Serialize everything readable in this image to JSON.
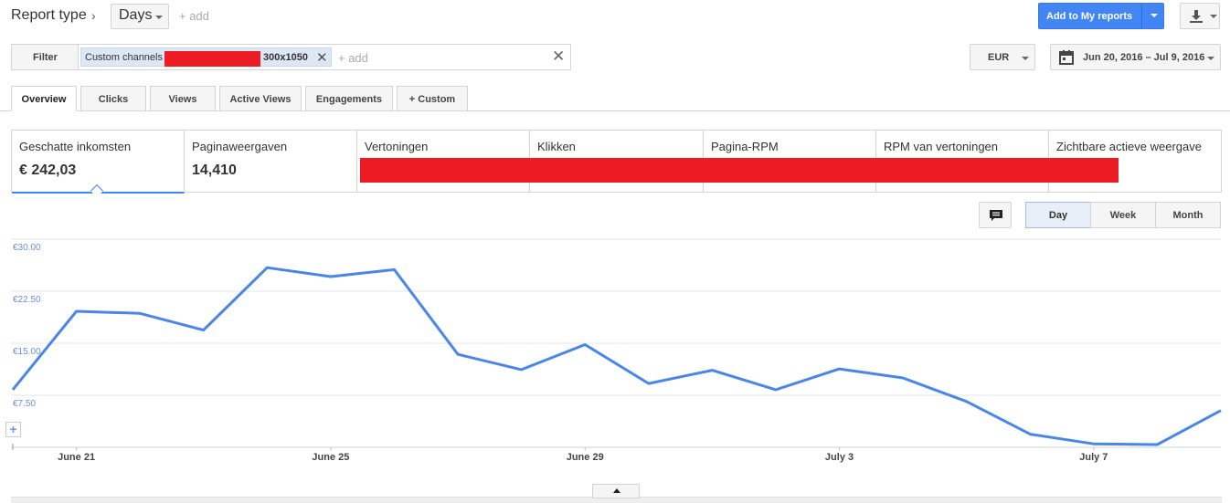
{
  "header": {
    "title": "Report type",
    "days_label": "Days",
    "add_label": "+ add",
    "add_reports_label": "Add to My reports"
  },
  "filter": {
    "button_label": "Filter",
    "chip_label": "Custom channels",
    "chip_size": "300x1050",
    "add_label": "+ add"
  },
  "currency": "EUR",
  "date_range": "Jun 20, 2016 – Jul 9, 2016",
  "tabs": [
    {
      "label": "Overview"
    },
    {
      "label": "Clicks"
    },
    {
      "label": "Views"
    },
    {
      "label": "Active Views"
    },
    {
      "label": "Engagements"
    },
    {
      "label": "+ Custom"
    }
  ],
  "metrics": [
    {
      "name": "Geschatte inkomsten",
      "value": "€ 242,03"
    },
    {
      "name": "Paginaweergaven",
      "value": "14,410"
    },
    {
      "name": "Vertoningen"
    },
    {
      "name": "Klikken"
    },
    {
      "name": "Pagina-RPM"
    },
    {
      "name": "RPM van vertoningen"
    },
    {
      "name": "Zichtbare actieve weergave"
    }
  ],
  "time_range": {
    "day": "Day",
    "week": "Week",
    "month": "Month"
  },
  "colors": {
    "accent": "#4285f4",
    "line": "#4a86e8",
    "redaction": "#ed1c24"
  },
  "chart_data": {
    "type": "line",
    "x": [
      "Jun 20",
      "Jun 21",
      "Jun 22",
      "Jun 23",
      "Jun 24",
      "Jun 25",
      "Jun 26",
      "Jun 27",
      "Jun 28",
      "Jun 29",
      "Jun 30",
      "Jul 1",
      "Jul 2",
      "Jul 3",
      "Jul 4",
      "Jul 5",
      "Jul 6",
      "Jul 7",
      "Jul 8",
      "Jul 9"
    ],
    "series": [
      {
        "values": [
          8.3,
          19.6,
          19.3,
          16.9,
          25.9,
          24.6,
          25.6,
          13.4,
          11.2,
          14.8,
          9.2,
          11.1,
          8.3,
          11.3,
          10.0,
          6.6,
          1.9,
          0.5,
          0.4,
          5.3
        ]
      }
    ],
    "xticks": [
      {
        "index": 1,
        "label": "June 21"
      },
      {
        "index": 5,
        "label": "June 25"
      },
      {
        "index": 9,
        "label": "June 29"
      },
      {
        "index": 13,
        "label": "July 3"
      },
      {
        "index": 17,
        "label": "July 7"
      }
    ],
    "yticks": [
      {
        "value": 30,
        "label": "€30.00"
      },
      {
        "value": 22.5,
        "label": "€22.50"
      },
      {
        "value": 15,
        "label": "€15.00"
      },
      {
        "value": 7.5,
        "label": "€7.50"
      }
    ],
    "ylim": [
      0,
      30
    ],
    "grid": true
  }
}
